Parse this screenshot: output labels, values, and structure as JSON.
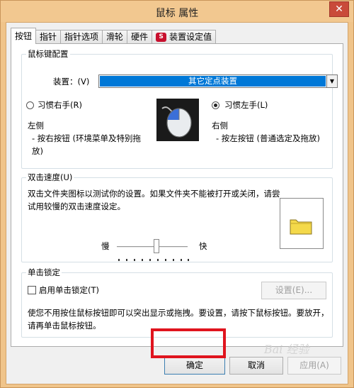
{
  "window": {
    "title": "鼠标 属性",
    "close_glyph": "✕"
  },
  "tabs": [
    {
      "label": "按钮",
      "active": true
    },
    {
      "label": "指针"
    },
    {
      "label": "指针选项"
    },
    {
      "label": "滑轮"
    },
    {
      "label": "硬件"
    },
    {
      "label": "装置设定值",
      "icon": "synaptics-icon"
    }
  ],
  "button_config": {
    "group_label": "鼠标键配置",
    "device_label": "装置：(V)",
    "device_value": "其它定点装置",
    "right_hand_label": "习惯右手(R)",
    "left_hand_label": "习惯左手(L)",
    "selected": "left_hand",
    "left_side_title": "左侧",
    "left_side_desc_1": "- 按右按钮 (环境菜单及特别拖",
    "left_side_desc_2": "放)",
    "right_side_title": "右侧",
    "right_side_desc": "- 按左按钮 (普通选定及拖放)"
  },
  "double_click": {
    "group_label": "双击速度(U)",
    "desc_1": "双击文件夹图标以测试你的设置。如果文件夹不能被打开或关闭，请尝",
    "desc_2": "试用较慢的双击速度设定。",
    "slow_label": "慢",
    "fast_label": "快",
    "speed_fraction": 0.6
  },
  "click_lock": {
    "group_label": "单击锁定",
    "checkbox_label": "启用单击锁定(T)",
    "checked": false,
    "settings_button": "设置(E)...",
    "desc_1": "使您不用按住鼠标按钮即可以突出显示或拖拽。要设置，请按下鼠标按钮。要放开，",
    "desc_2": "请再单击鼠标按钮。"
  },
  "footer": {
    "ok_label": "确定",
    "cancel_label": "取消",
    "apply_label": "应用(A)"
  },
  "watermark": "Bai 经验",
  "colors": {
    "highlight_border": "#e0141e",
    "selection": "#0078d7",
    "title_bar": "#f2c890"
  }
}
